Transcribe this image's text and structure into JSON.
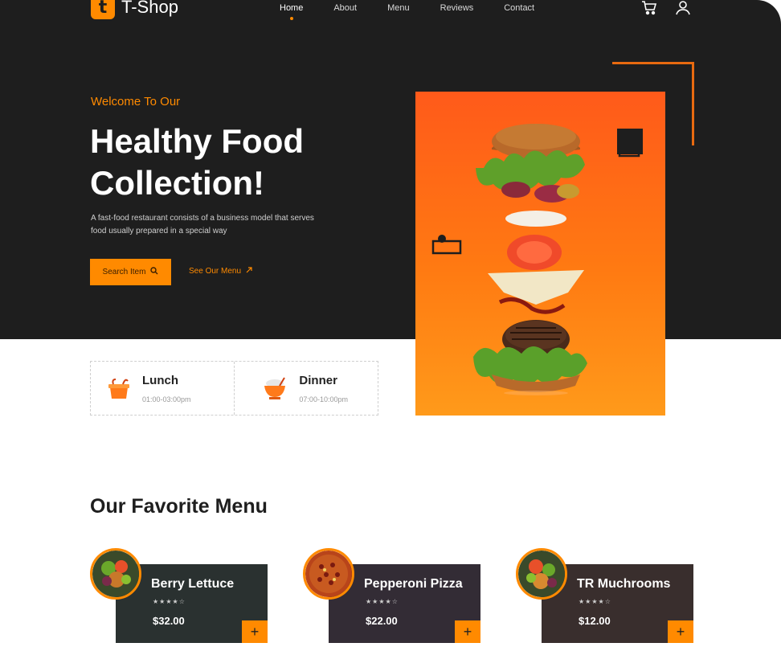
{
  "brand": {
    "logo_letter": "t",
    "name": "T-Shop"
  },
  "nav": {
    "items": [
      "Home",
      "About",
      "Menu",
      "Reviews",
      "Contact"
    ],
    "active": "Home"
  },
  "header_icons": [
    "cart-icon",
    "user-icon"
  ],
  "hero": {
    "kicker": "Welcome To Our",
    "title_line1": "Healthy Food",
    "title_line2": "Collection!",
    "description": "A fast-food restaurant consists of a business model that serves food usually prepared in a special way",
    "search_button": "Search Item",
    "menu_link": "See Our Menu"
  },
  "meals": [
    {
      "name": "Lunch",
      "time": "01:00-03:00pm",
      "icon": "lunch-box-icon"
    },
    {
      "name": "Dinner",
      "time": "07:00-10:00pm",
      "icon": "rice-bowl-icon"
    }
  ],
  "section": {
    "title": "Our Favorite Menu"
  },
  "menu_items": [
    {
      "name": "Berry Lettuce",
      "rating_text": "★★★★☆",
      "price": "$32.00",
      "add": "+"
    },
    {
      "name": "Pepperoni Pizza",
      "rating_text": "★★★★☆",
      "price": "$22.00",
      "add": "+"
    },
    {
      "name": "TR Muchrooms",
      "rating_text": "★★★★☆",
      "price": "$12.00",
      "add": "+"
    }
  ],
  "colors": {
    "accent": "#ff8a00",
    "hero_bg": "#1e1e1e",
    "card1": "#2a3130",
    "card2": "#332c35",
    "card3": "#392e2d"
  }
}
